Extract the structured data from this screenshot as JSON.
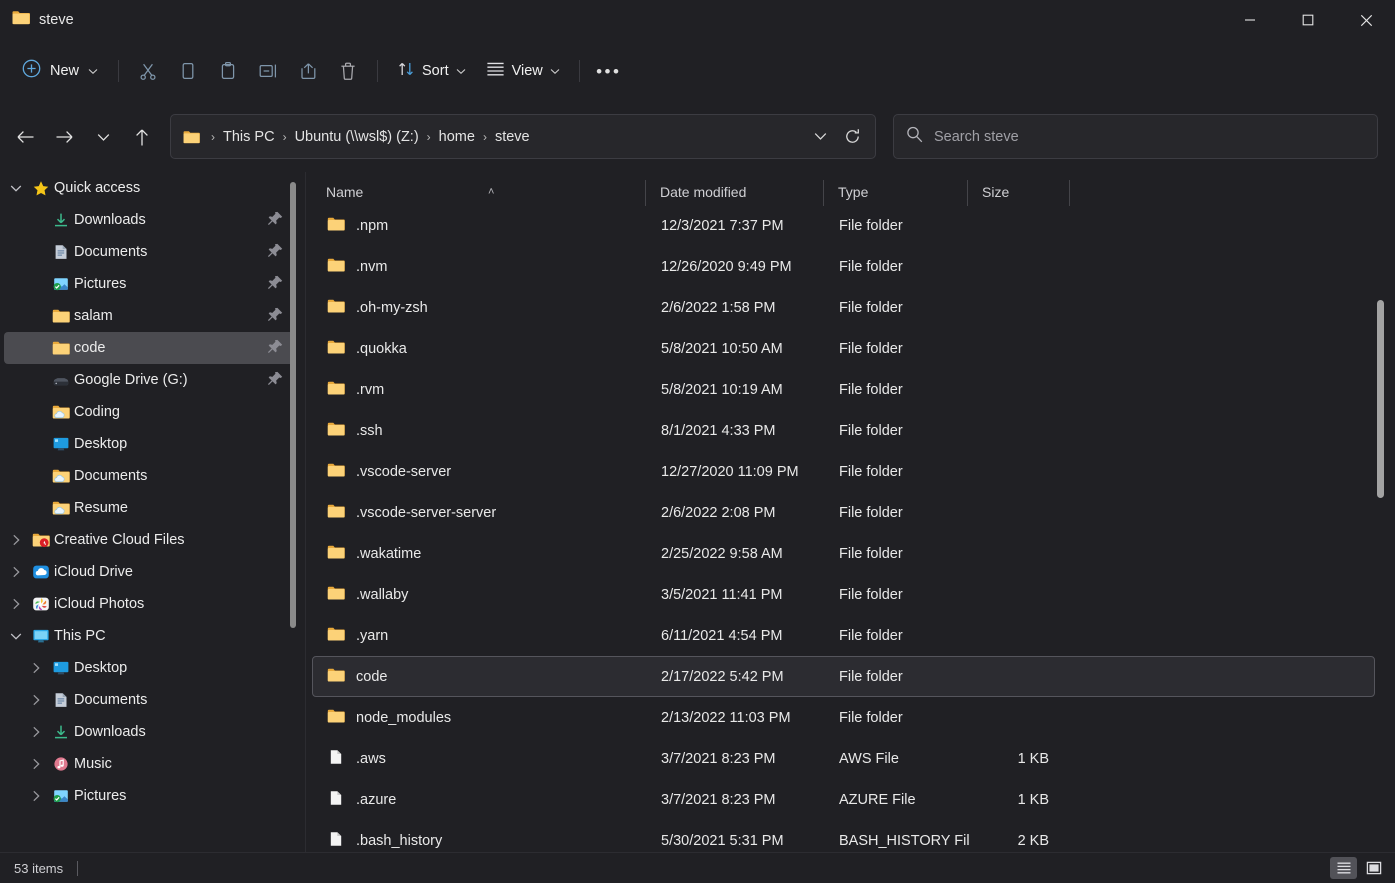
{
  "window": {
    "title": "steve",
    "title_icon": "folder-icon",
    "minimize_label": "Minimize",
    "maximize_label": "Maximize",
    "close_label": "Close"
  },
  "toolbar": {
    "new_label": "New",
    "sort_label": "Sort",
    "view_label": "View",
    "overflow_label": "•••",
    "icons": [
      {
        "name": "cut-icon",
        "label": "Cut"
      },
      {
        "name": "copy-icon",
        "label": "Copy"
      },
      {
        "name": "paste-icon",
        "label": "Paste"
      },
      {
        "name": "rename-icon",
        "label": "Rename"
      },
      {
        "name": "share-icon",
        "label": "Share"
      },
      {
        "name": "delete-icon",
        "label": "Delete"
      }
    ]
  },
  "navigation": {
    "back_label": "Back",
    "forward_label": "Forward",
    "recent_label": "Recent locations",
    "up_label": "Up to home",
    "breadcrumb": [
      "This PC",
      "Ubuntu (\\\\wsl$) (Z:)",
      "home",
      "steve"
    ],
    "separator": "›",
    "dropdown_label": "Previous locations",
    "refresh_label": "Refresh"
  },
  "search": {
    "placeholder": "Search steve",
    "value": ""
  },
  "sidebar": {
    "items": [
      {
        "label": "Quick access",
        "icon": "star-icon",
        "indent": 0,
        "chevron": "down",
        "pinned": false,
        "selected": false
      },
      {
        "label": "Downloads",
        "icon": "downloads-icon",
        "indent": 1,
        "chevron": "none",
        "pinned": true,
        "selected": false
      },
      {
        "label": "Documents",
        "icon": "documents-icon",
        "indent": 1,
        "chevron": "none",
        "pinned": true,
        "selected": false
      },
      {
        "label": "Pictures",
        "icon": "pictures-icon",
        "indent": 1,
        "chevron": "none",
        "pinned": true,
        "selected": false
      },
      {
        "label": "salam",
        "icon": "folder-icon",
        "indent": 1,
        "chevron": "none",
        "pinned": true,
        "selected": false
      },
      {
        "label": "code",
        "icon": "folder-icon",
        "indent": 1,
        "chevron": "none",
        "pinned": true,
        "selected": true
      },
      {
        "label": "Google Drive (G:)",
        "icon": "drive-icon",
        "indent": 1,
        "chevron": "none",
        "pinned": true,
        "selected": false
      },
      {
        "label": "Coding",
        "icon": "onedrive-folder-icon",
        "indent": 1,
        "chevron": "none",
        "pinned": false,
        "selected": false
      },
      {
        "label": "Desktop",
        "icon": "desktop-icon",
        "indent": 1,
        "chevron": "none",
        "pinned": false,
        "selected": false
      },
      {
        "label": "Documents",
        "icon": "onedrive-folder-icon",
        "indent": 1,
        "chevron": "none",
        "pinned": false,
        "selected": false
      },
      {
        "label": "Resume",
        "icon": "onedrive-folder-icon",
        "indent": 1,
        "chevron": "none",
        "pinned": false,
        "selected": false
      },
      {
        "label": "Creative Cloud Files",
        "icon": "creative-cloud-icon",
        "indent": 0,
        "chevron": "right",
        "pinned": false,
        "selected": false
      },
      {
        "label": "iCloud Drive",
        "icon": "icloud-drive-icon",
        "indent": 0,
        "chevron": "right",
        "pinned": false,
        "selected": false
      },
      {
        "label": "iCloud Photos",
        "icon": "icloud-photos-icon",
        "indent": 0,
        "chevron": "right",
        "pinned": false,
        "selected": false
      },
      {
        "label": "This PC",
        "icon": "this-pc-icon",
        "indent": 0,
        "chevron": "down",
        "pinned": false,
        "selected": false
      },
      {
        "label": "Desktop",
        "icon": "desktop-icon",
        "indent": 1,
        "chevron": "right",
        "pinned": false,
        "selected": false
      },
      {
        "label": "Documents",
        "icon": "documents-icon",
        "indent": 1,
        "chevron": "right",
        "pinned": false,
        "selected": false
      },
      {
        "label": "Downloads",
        "icon": "downloads-icon",
        "indent": 1,
        "chevron": "right",
        "pinned": false,
        "selected": false
      },
      {
        "label": "Music",
        "icon": "music-icon",
        "indent": 1,
        "chevron": "right",
        "pinned": false,
        "selected": false
      },
      {
        "label": "Pictures",
        "icon": "pictures-icon",
        "indent": 1,
        "chevron": "right",
        "pinned": false,
        "selected": false
      }
    ]
  },
  "filelist": {
    "columns": [
      {
        "key": "name",
        "label": "Name",
        "sorted": "asc"
      },
      {
        "key": "date",
        "label": "Date modified",
        "sorted": "none"
      },
      {
        "key": "type",
        "label": "Type",
        "sorted": "none"
      },
      {
        "key": "size",
        "label": "Size",
        "sorted": "none"
      }
    ],
    "sort_glyph": "˄",
    "rows": [
      {
        "name": ".npm",
        "date": "12/3/2021 7:37 PM",
        "type": "File folder",
        "size": "",
        "icon": "folder-icon",
        "selected": false
      },
      {
        "name": ".nvm",
        "date": "12/26/2020 9:49 PM",
        "type": "File folder",
        "size": "",
        "icon": "folder-icon",
        "selected": false
      },
      {
        "name": ".oh-my-zsh",
        "date": "2/6/2022 1:58 PM",
        "type": "File folder",
        "size": "",
        "icon": "folder-icon",
        "selected": false
      },
      {
        "name": ".quokka",
        "date": "5/8/2021 10:50 AM",
        "type": "File folder",
        "size": "",
        "icon": "folder-icon",
        "selected": false
      },
      {
        "name": ".rvm",
        "date": "5/8/2021 10:19 AM",
        "type": "File folder",
        "size": "",
        "icon": "folder-icon",
        "selected": false
      },
      {
        "name": ".ssh",
        "date": "8/1/2021 4:33 PM",
        "type": "File folder",
        "size": "",
        "icon": "folder-icon",
        "selected": false
      },
      {
        "name": ".vscode-server",
        "date": "12/27/2020 11:09 PM",
        "type": "File folder",
        "size": "",
        "icon": "folder-icon",
        "selected": false
      },
      {
        "name": ".vscode-server-server",
        "date": "2/6/2022 2:08 PM",
        "type": "File folder",
        "size": "",
        "icon": "folder-icon",
        "selected": false
      },
      {
        "name": ".wakatime",
        "date": "2/25/2022 9:58 AM",
        "type": "File folder",
        "size": "",
        "icon": "folder-icon",
        "selected": false
      },
      {
        "name": ".wallaby",
        "date": "3/5/2021 11:41 PM",
        "type": "File folder",
        "size": "",
        "icon": "folder-icon",
        "selected": false
      },
      {
        "name": ".yarn",
        "date": "6/11/2021 4:54 PM",
        "type": "File folder",
        "size": "",
        "icon": "folder-icon",
        "selected": false
      },
      {
        "name": "code",
        "date": "2/17/2022 5:42 PM",
        "type": "File folder",
        "size": "",
        "icon": "folder-icon",
        "selected": true
      },
      {
        "name": "node_modules",
        "date": "2/13/2022 11:03 PM",
        "type": "File folder",
        "size": "",
        "icon": "folder-icon",
        "selected": false
      },
      {
        "name": ".aws",
        "date": "3/7/2021 8:23 PM",
        "type": "AWS File",
        "size": "1 KB",
        "icon": "file-icon",
        "selected": false
      },
      {
        "name": ".azure",
        "date": "3/7/2021 8:23 PM",
        "type": "AZURE File",
        "size": "1 KB",
        "icon": "file-icon",
        "selected": false
      },
      {
        "name": ".bash_history",
        "date": "5/30/2021 5:31 PM",
        "type": "BASH_HISTORY File",
        "size": "2 KB",
        "icon": "file-icon",
        "selected": false
      }
    ]
  },
  "statusbar": {
    "item_count": "53 items",
    "details_view_label": "Details view",
    "large_icons_view_label": "Large icons view"
  },
  "colors": {
    "window_bg": "#202024",
    "folder_yellow": "#f7c95c",
    "accent_blue": "#4a9eda",
    "selection_bg": "#4b4b50",
    "row_selected_bg": "#2c2c31",
    "text_primary": "#e9e9e9",
    "text_secondary": "#a0a0a6"
  }
}
